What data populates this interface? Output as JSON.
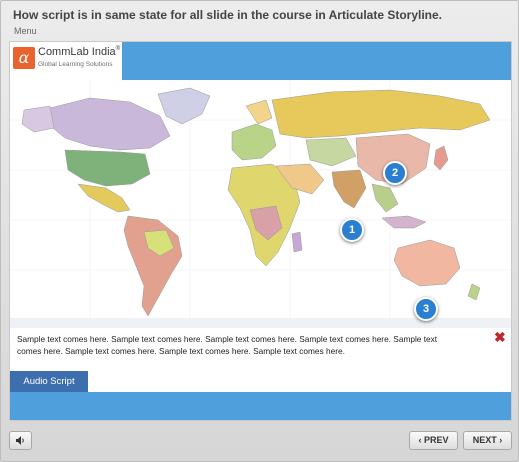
{
  "header": {
    "title": "How script is in same state for all slide in the course in Articulate Storyline.",
    "menu_label": "Menu"
  },
  "logo": {
    "name": "CommLab India",
    "registered": "®",
    "tagline": "Global Learning Solutions",
    "mark": "α",
    "brand_color": "#e8632d"
  },
  "colors": {
    "bar_blue": "#4e9fdb",
    "tab_blue": "#3d6fae",
    "hotspot_blue": "#2a7fd0",
    "close_red": "#c0262c"
  },
  "hotspots": [
    {
      "label": "1"
    },
    {
      "label": "2"
    },
    {
      "label": "3"
    }
  ],
  "script_panel": {
    "text": "Sample text comes here. Sample text comes here. Sample text comes here. Sample text comes here. Sample text comes here. Sample text comes here. Sample text comes here. Sample text comes here.",
    "close_icon": "close-x-icon"
  },
  "audio_script_tab": "Audio Script",
  "controls": {
    "volume_icon": "speaker-icon",
    "prev_label": "PREV",
    "next_label": "NEXT",
    "prev_icon": "‹",
    "next_icon": "›"
  }
}
